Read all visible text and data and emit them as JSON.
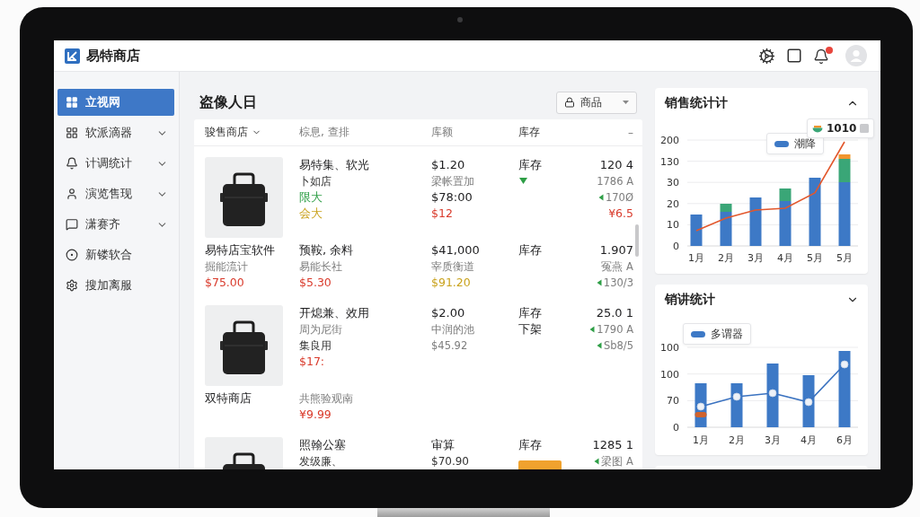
{
  "header": {
    "title": "易特商店",
    "notifications": true
  },
  "sidebar": {
    "items": [
      {
        "label": "立视网",
        "selected": true,
        "expandable": false
      },
      {
        "label": "软派滴器",
        "selected": false,
        "expandable": true
      },
      {
        "label": "计调统计",
        "selected": false,
        "expandable": true
      },
      {
        "label": "演览售现",
        "selected": false,
        "expandable": true
      },
      {
        "label": "潇赛齐",
        "selected": false,
        "expandable": true
      },
      {
        "label": "新镂软合",
        "selected": false,
        "expandable": false
      },
      {
        "label": "搜加离服",
        "selected": false,
        "expandable": false
      }
    ]
  },
  "main": {
    "title": "盗像人日",
    "filter_button": {
      "label": "商品"
    }
  },
  "table": {
    "columns": [
      {
        "label": "骏售商店",
        "kind": "strong",
        "sortable": true
      },
      {
        "label": "棕息, 查排",
        "kind": "muted",
        "sortable": false
      },
      {
        "label": "库额",
        "kind": "muted",
        "sortable": false
      },
      {
        "label": "库存",
        "kind": "strong",
        "sortable": false
      },
      {
        "label": "–",
        "kind": "muted",
        "sortable": false
      }
    ],
    "rows": [
      {
        "blocks": [
          {
            "column_1": [
              {
                "kind": "photo"
              }
            ],
            "column_2": [
              {
                "kind": "strong",
                "text": "易特集、软光"
              },
              {
                "kind": "text",
                "text": "卜如店"
              },
              {
                "kind": "accent",
                "text": "限大",
                "color": "#2e9e46"
              },
              {
                "kind": "accent",
                "text": "会大",
                "color": "#c9a21c"
              }
            ],
            "column_3": [
              {
                "kind": "strong",
                "text": "$1.20"
              },
              {
                "kind": "muted",
                "text": "梁帐置加"
              },
              {
                "kind": "strong",
                "text": "$78:00"
              },
              {
                "kind": "accent",
                "text": "$12",
                "color": "#d93a2b"
              }
            ],
            "column_4": [
              {
                "kind": "strong",
                "text": "库存"
              },
              {
                "kind": "indicator",
                "color": "#2e9e46"
              }
            ],
            "column_5": [
              {
                "kind": "strong",
                "text": "120 4"
              },
              {
                "kind": "muted",
                "text": "1786 A",
                "arrow": false
              },
              {
                "kind": "muted",
                "text": "170Ø",
                "arrow": true
              },
              {
                "kind": "accent",
                "text": "¥6.5",
                "color": "#d93a2b"
              }
            ]
          },
          {
            "column_1": [
              {
                "kind": "strong",
                "text": "易特店宝软件"
              },
              {
                "kind": "muted",
                "text": "掘能流计"
              },
              {
                "kind": "accent",
                "text": "$75.00",
                "color": "#d93a2b"
              }
            ],
            "column_2": [
              {
                "kind": "strong",
                "text": "预鞍, 余料"
              },
              {
                "kind": "muted",
                "text": "易能长社"
              },
              {
                "kind": "accent",
                "text": "$5.30",
                "color": "#d93a2b"
              }
            ],
            "column_3": [
              {
                "kind": "strong",
                "text": "$41,000"
              },
              {
                "kind": "muted",
                "text": "宰质衡道"
              },
              {
                "kind": "accent",
                "text": "$91.20",
                "color": "#c9a21c"
              }
            ],
            "column_4": [
              {
                "kind": "strong",
                "text": "库存"
              }
            ],
            "column_5": [
              {
                "kind": "strong",
                "text": "1.907"
              },
              {
                "kind": "muted",
                "text": "冤燕 A",
                "arrow": false
              },
              {
                "kind": "muted",
                "text": "130/3",
                "arrow": true
              }
            ]
          }
        ]
      },
      {
        "blocks": [
          {
            "column_1": [
              {
                "kind": "photo"
              }
            ],
            "column_2": [
              {
                "kind": "strong",
                "text": "开熄兼、效用"
              },
              {
                "kind": "muted",
                "text": "周为尼街"
              },
              {
                "kind": "text",
                "text": "集良用"
              },
              {
                "kind": "accent",
                "text": "$17:",
                "color": "#d93a2b"
              }
            ],
            "column_3": [
              {
                "kind": "strong",
                "text": "$2.00"
              },
              {
                "kind": "muted",
                "text": "中润的池"
              },
              {
                "kind": "muted",
                "text": "$45.92"
              }
            ],
            "column_4": [
              {
                "kind": "strong",
                "text": "库存"
              },
              {
                "kind": "strong",
                "text": "下架"
              }
            ],
            "column_5": [
              {
                "kind": "strong",
                "text": "25.0 1"
              },
              {
                "kind": "muted",
                "text": "1790 A",
                "arrow": true
              },
              {
                "kind": "muted",
                "text": "Sb8/5",
                "arrow": true
              }
            ]
          },
          {
            "column_1": [
              {
                "kind": "strong",
                "text": "双特商店"
              }
            ],
            "column_2": [
              {
                "kind": "muted",
                "text": "共熊验观南"
              },
              {
                "kind": "accent",
                "text": "¥9.99",
                "color": "#d93a2b"
              }
            ]
          }
        ]
      },
      {
        "blocks": [
          {
            "column_1": [
              {
                "kind": "photo"
              }
            ],
            "column_2": [
              {
                "kind": "strong",
                "text": "照翰公塞"
              },
              {
                "kind": "text",
                "text": "发级廉、"
              }
            ],
            "column_3": [
              {
                "kind": "strong",
                "text": "审算"
              },
              {
                "kind": "text",
                "text": "$70.90"
              }
            ],
            "column_4": [
              {
                "kind": "strong",
                "text": "库存"
              },
              {
                "kind": "tag",
                "color": "#f0a22e"
              }
            ],
            "column_5": [
              {
                "kind": "strong",
                "text": "1285 1"
              },
              {
                "kind": "muted",
                "text": "梁图 A",
                "arrow": true
              }
            ]
          }
        ]
      }
    ]
  },
  "cards": [
    {
      "title": "销售统计计",
      "expanded": true,
      "tooltip": "1010",
      "legend": "潮降",
      "y_labels": [
        "200",
        "130",
        "30",
        "20",
        "10",
        "0"
      ],
      "x_labels": [
        "1月",
        "2月",
        "3月",
        "4月",
        "5月",
        "5月"
      ]
    },
    {
      "title": "销讲统计",
      "expanded": false,
      "legend": "多谓器",
      "y_labels": [
        "100",
        "100",
        "70",
        "0"
      ],
      "x_labels": [
        "1月",
        "2月",
        "3月",
        "4月",
        "6月"
      ]
    }
  ]
}
